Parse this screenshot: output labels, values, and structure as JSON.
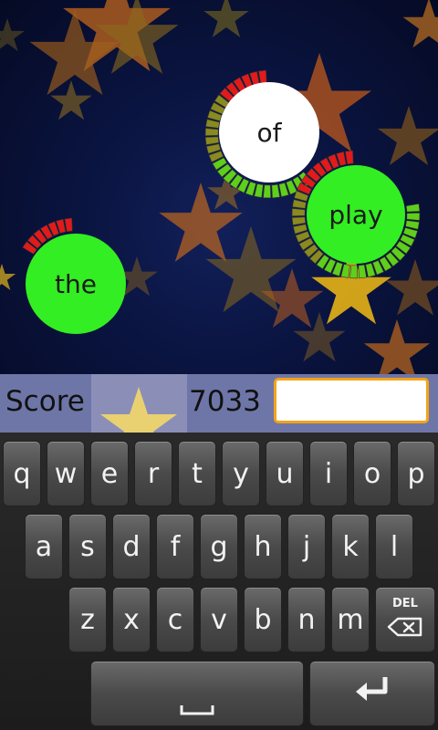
{
  "game": {
    "bubbles": [
      {
        "word": "of",
        "disc_color": "#ffffff",
        "timer_fraction": 0.62
      },
      {
        "word": "play",
        "disc_color": "#33ee22",
        "timer_fraction": 0.78
      },
      {
        "word": "the",
        "disc_color": "#33ee22",
        "timer_fraction": 0.15
      }
    ]
  },
  "scorebar": {
    "label": "Score",
    "value": "7033",
    "input_value": ""
  },
  "keyboard": {
    "row1": [
      "q",
      "w",
      "e",
      "r",
      "t",
      "y",
      "u",
      "i",
      "o",
      "p"
    ],
    "row2": [
      "a",
      "s",
      "d",
      "f",
      "g",
      "h",
      "j",
      "k",
      "l"
    ],
    "row3": [
      "z",
      "x",
      "c",
      "v",
      "b",
      "n",
      "m"
    ],
    "del_label": "DEL",
    "space_label": "␣",
    "enter_label": "↵"
  },
  "colors": {
    "timer_red": "#e21a1a",
    "timer_green": "#5ecf1a",
    "timer_olive": "#8a8a1e",
    "input_border": "#f3a31a",
    "scorebar_bg": "#6e76a8"
  },
  "icons": [
    "star-icon",
    "backspace-icon",
    "space-icon",
    "enter-icon"
  ]
}
